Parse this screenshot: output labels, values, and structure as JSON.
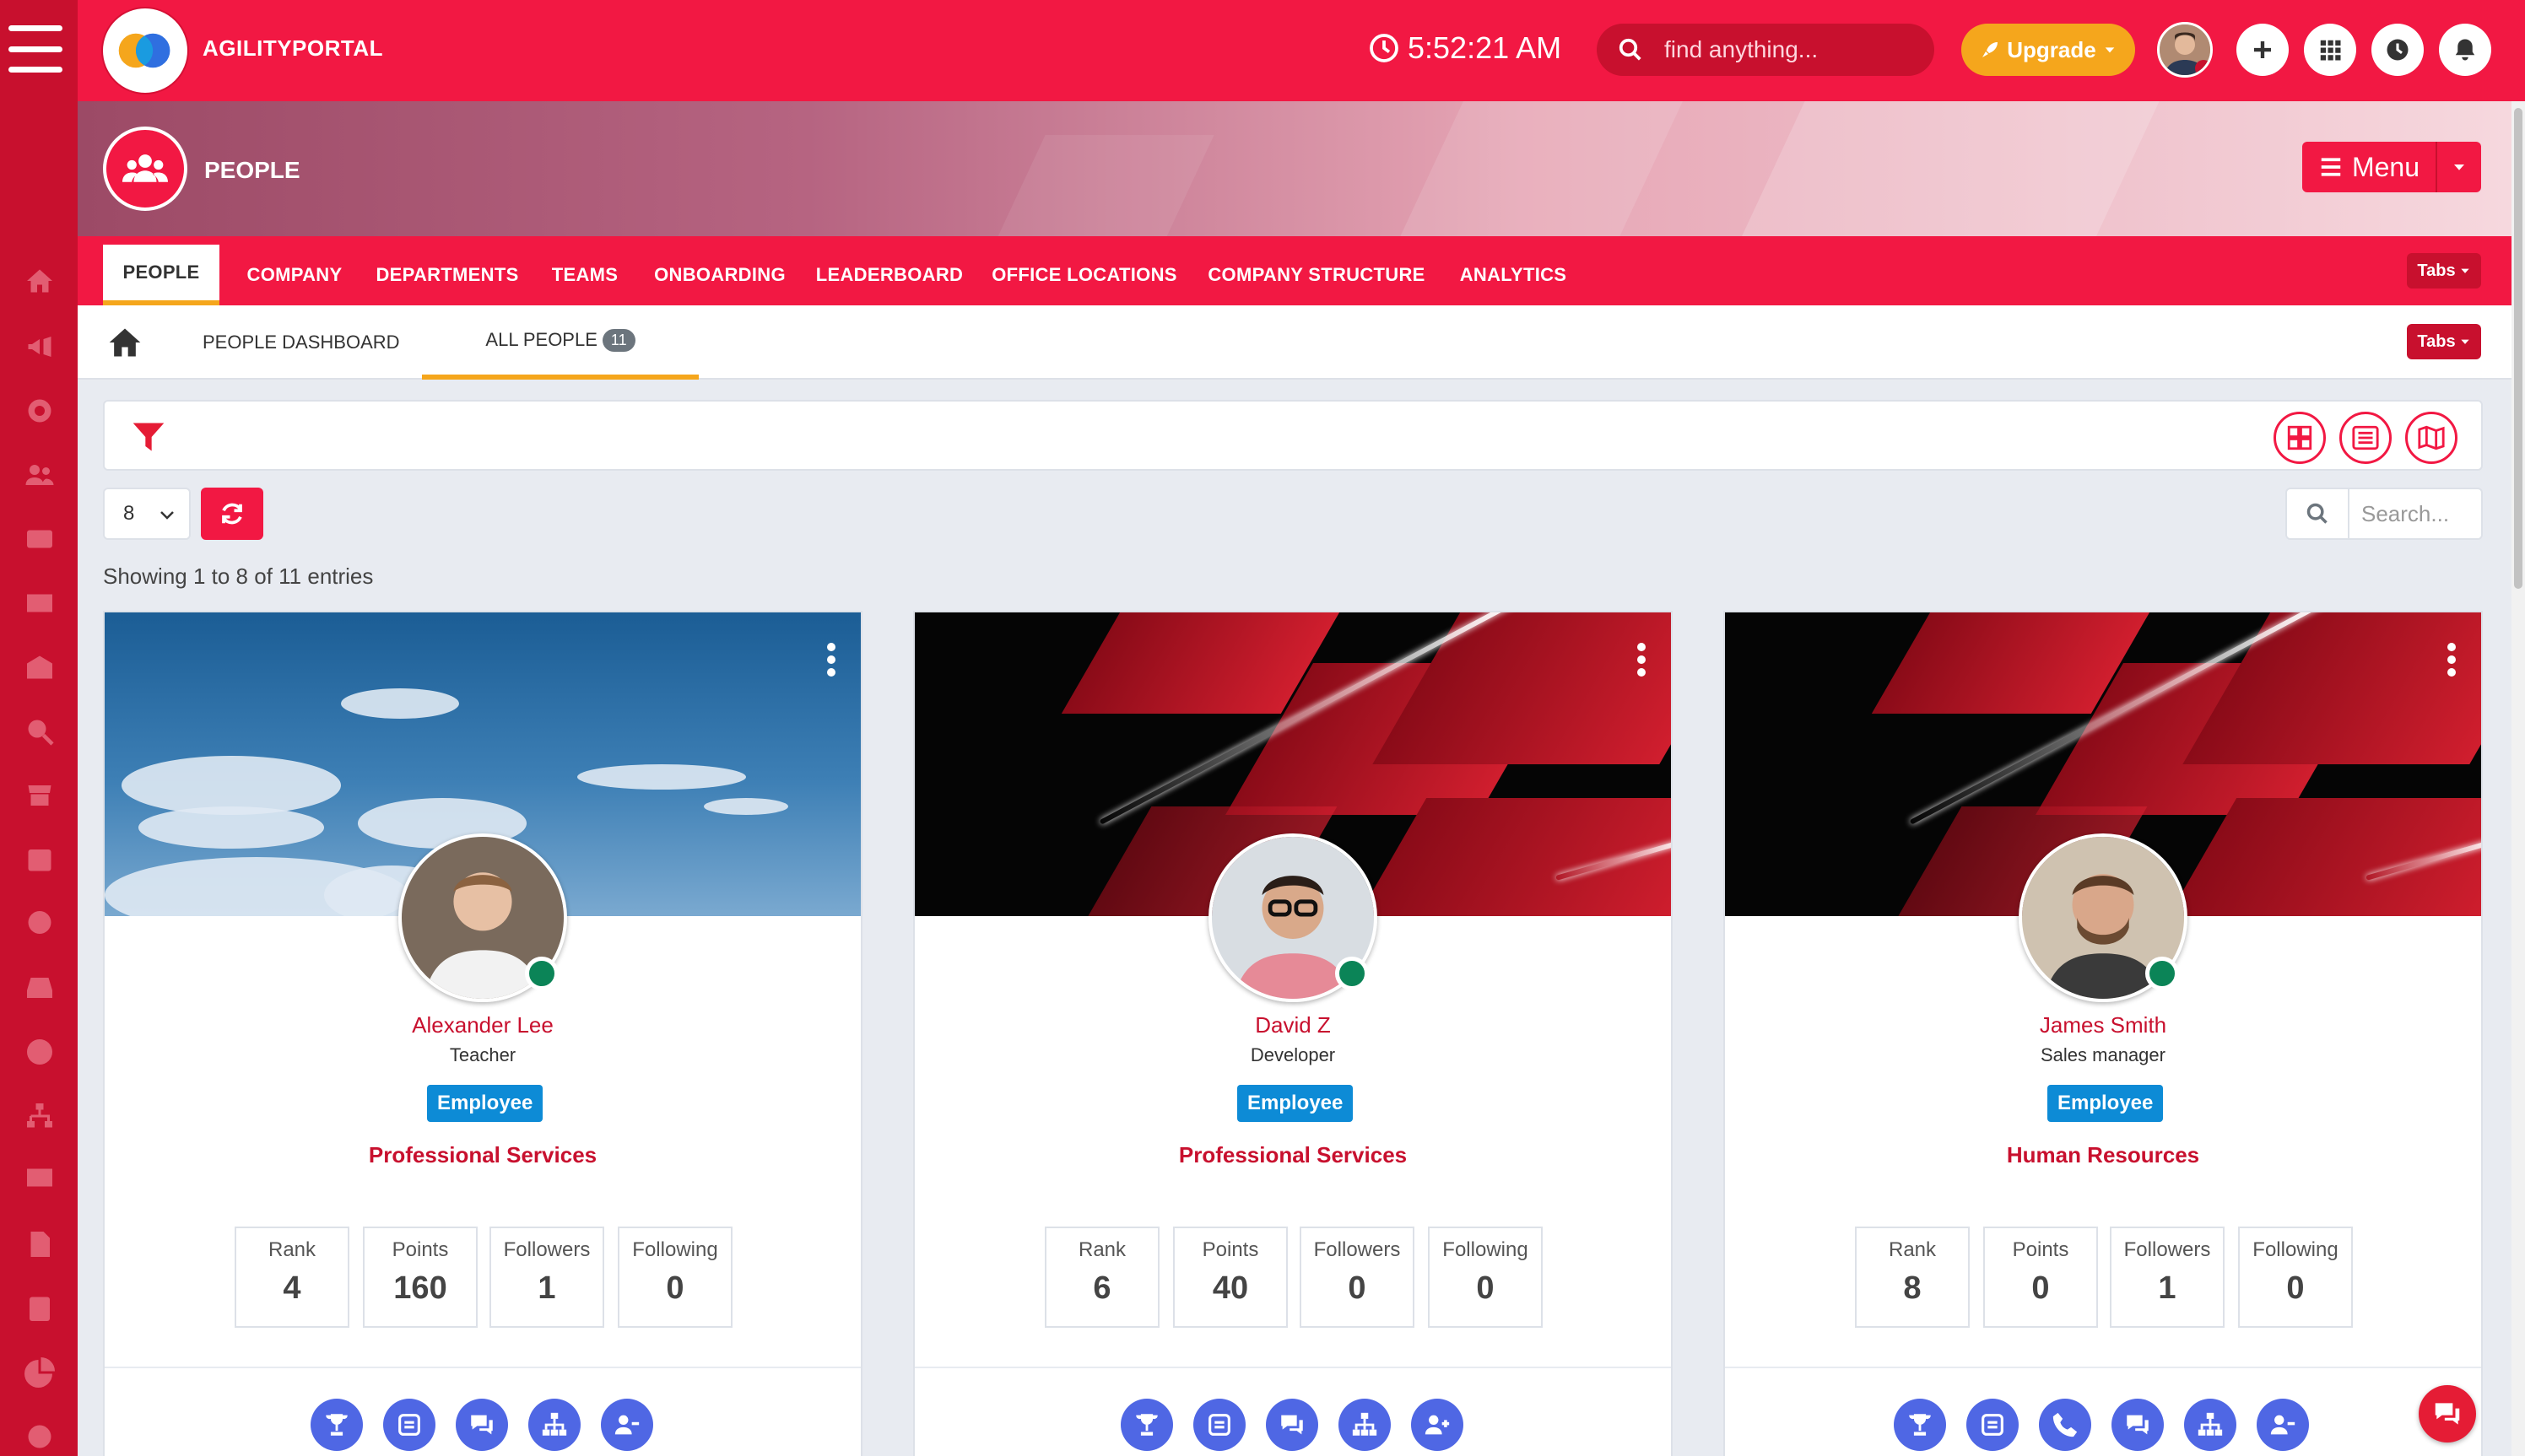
{
  "app": {
    "brand": "AGILITYPORTAL",
    "time": "5:52:21 AM",
    "search_placeholder": "find anything...",
    "upgrade_label": "Upgrade"
  },
  "hero": {
    "title": "PEOPLE",
    "menu_label": "Menu"
  },
  "tabs": [
    "PEOPLE",
    "COMPANY",
    "DEPARTMENTS",
    "TEAMS",
    "ONBOARDING",
    "LEADERBOARD",
    "OFFICE LOCATIONS",
    "COMPANY STRUCTURE",
    "ANALYTICS"
  ],
  "tabs_dropdown_label": "Tabs",
  "subtabs": {
    "dashboard": "PEOPLE DASHBOARD",
    "all": "ALL PEOPLE",
    "count": "11",
    "dropdown_label": "Tabs"
  },
  "table": {
    "page_size": "8",
    "search_placeholder": "Search...",
    "showing": "Showing 1 to 8 of 11 entries"
  },
  "stat_labels": {
    "rank": "Rank",
    "points": "Points",
    "followers": "Followers",
    "following": "Following"
  },
  "people": [
    {
      "name": "Alexander Lee",
      "role": "Teacher",
      "type": "Employee",
      "department": "Professional Services",
      "rank": "4",
      "points": "160",
      "followers": "1",
      "following": "0"
    },
    {
      "name": "David Z",
      "role": "Developer",
      "type": "Employee",
      "department": "Professional Services",
      "rank": "6",
      "points": "40",
      "followers": "0",
      "following": "0"
    },
    {
      "name": "James Smith",
      "role": "Sales manager",
      "type": "Employee",
      "department": "Human Resources",
      "rank": "8",
      "points": "0",
      "followers": "1",
      "following": "0"
    }
  ],
  "colors": {
    "primary": "#f21843",
    "rail": "#c8102e",
    "accent": "#f5a61c",
    "badge": "#0d8bd6",
    "action": "#4f67e4",
    "online": "#0b8457"
  }
}
